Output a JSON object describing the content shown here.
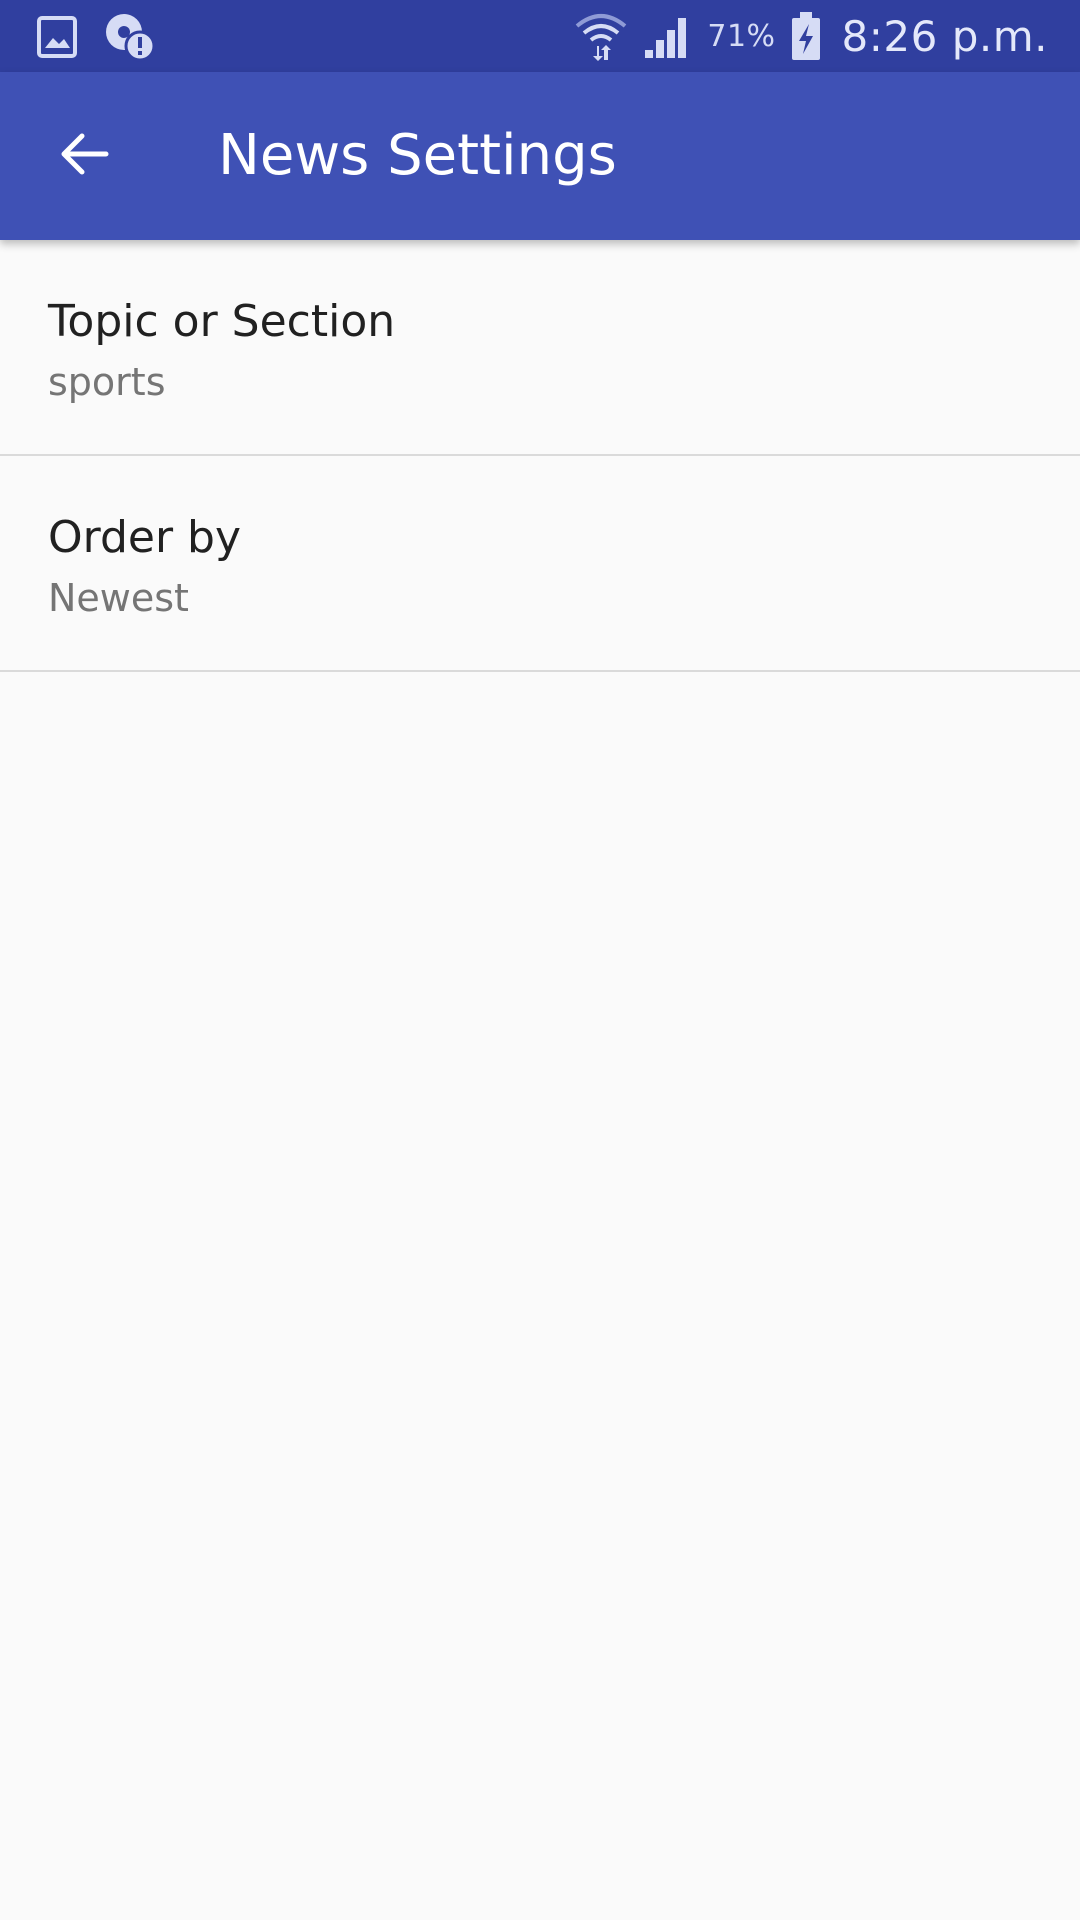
{
  "status_bar": {
    "battery": "71%",
    "time": "8:26 p.m.",
    "icons": [
      "gallery-icon",
      "alert-icon",
      "wifi-icon",
      "signal-icon",
      "battery-charging-icon"
    ]
  },
  "app_bar": {
    "title": "News Settings",
    "back_icon": "arrow-back-icon",
    "color": "#3f51b5"
  },
  "preferences": [
    {
      "title": "Topic or Section",
      "summary": "sports"
    },
    {
      "title": "Order by",
      "summary": "Newest"
    }
  ],
  "colors": {
    "status_bar": "#303f9f",
    "app_bar": "#3f51b5",
    "background": "#fafafa",
    "divider": "#dadada"
  }
}
